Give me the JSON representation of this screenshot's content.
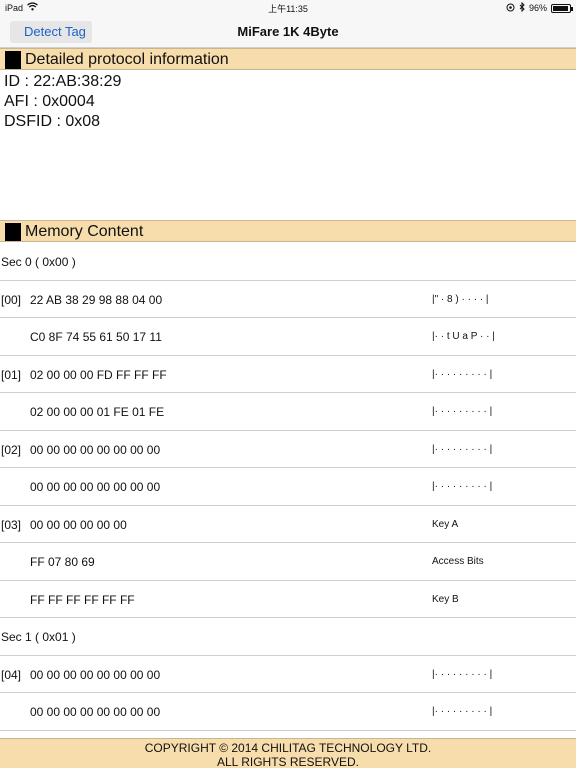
{
  "status_bar": {
    "device": "iPad",
    "time": "上午11:35",
    "battery": "96%",
    "battery_level": 0.96
  },
  "nav": {
    "back_label": "Detect Tag",
    "title": "MiFare 1K 4Byte"
  },
  "protocol_section": {
    "title": "Detailed protocol information",
    "lines": [
      "ID : 22:AB:38:29",
      "AFI : 0x0004",
      "DSFID : 0x08"
    ]
  },
  "memory_section": {
    "title": "Memory Content",
    "rows": [
      {
        "c1": "Sec  0 ( 0x00 )",
        "c2": "",
        "c3": ""
      },
      {
        "c1": "[00]",
        "c2": "22 AB 38 29 98 88 04 00",
        "c3": "|\" · 8 ) · · · · |"
      },
      {
        "c1": "",
        "c2": "C0 8F 74 55 61 50 17 11",
        "c3": "|· · t U a P · · |"
      },
      {
        "c1": "[01]",
        "c2": "02 00 00 00 FD FF FF FF",
        "c3": "|· · · · · · · · · |"
      },
      {
        "c1": "",
        "c2": "02 00 00 00 01 FE 01 FE",
        "c3": "|· · · · · · · · · |"
      },
      {
        "c1": "[02]",
        "c2": "00 00 00 00 00 00 00 00",
        "c3": "|· · · · · · · · · |"
      },
      {
        "c1": "",
        "c2": "00 00 00 00 00 00 00 00",
        "c3": "|· · · · · · · · · |"
      },
      {
        "c1": "[03]",
        "c2": "00 00 00 00 00 00",
        "c3": "Key A"
      },
      {
        "c1": "",
        "c2": "FF 07 80 69",
        "c3": "Access Bits"
      },
      {
        "c1": "",
        "c2": "FF FF FF FF FF FF",
        "c3": "Key B"
      },
      {
        "c1": "Sec  1 ( 0x01 )",
        "c2": "",
        "c3": ""
      },
      {
        "c1": "[04]",
        "c2": "00 00 00 00 00 00 00 00",
        "c3": "|· · · · · · · · · |"
      },
      {
        "c1": "",
        "c2": "00 00 00 00 00 00 00 00",
        "c3": "|· · · · · · · · · |"
      }
    ]
  },
  "footer": {
    "line1": "COPYRIGHT © 2014 CHILITAG TECHNOLOGY LTD.",
    "line2": "ALL RIGHTS RESERVED."
  }
}
